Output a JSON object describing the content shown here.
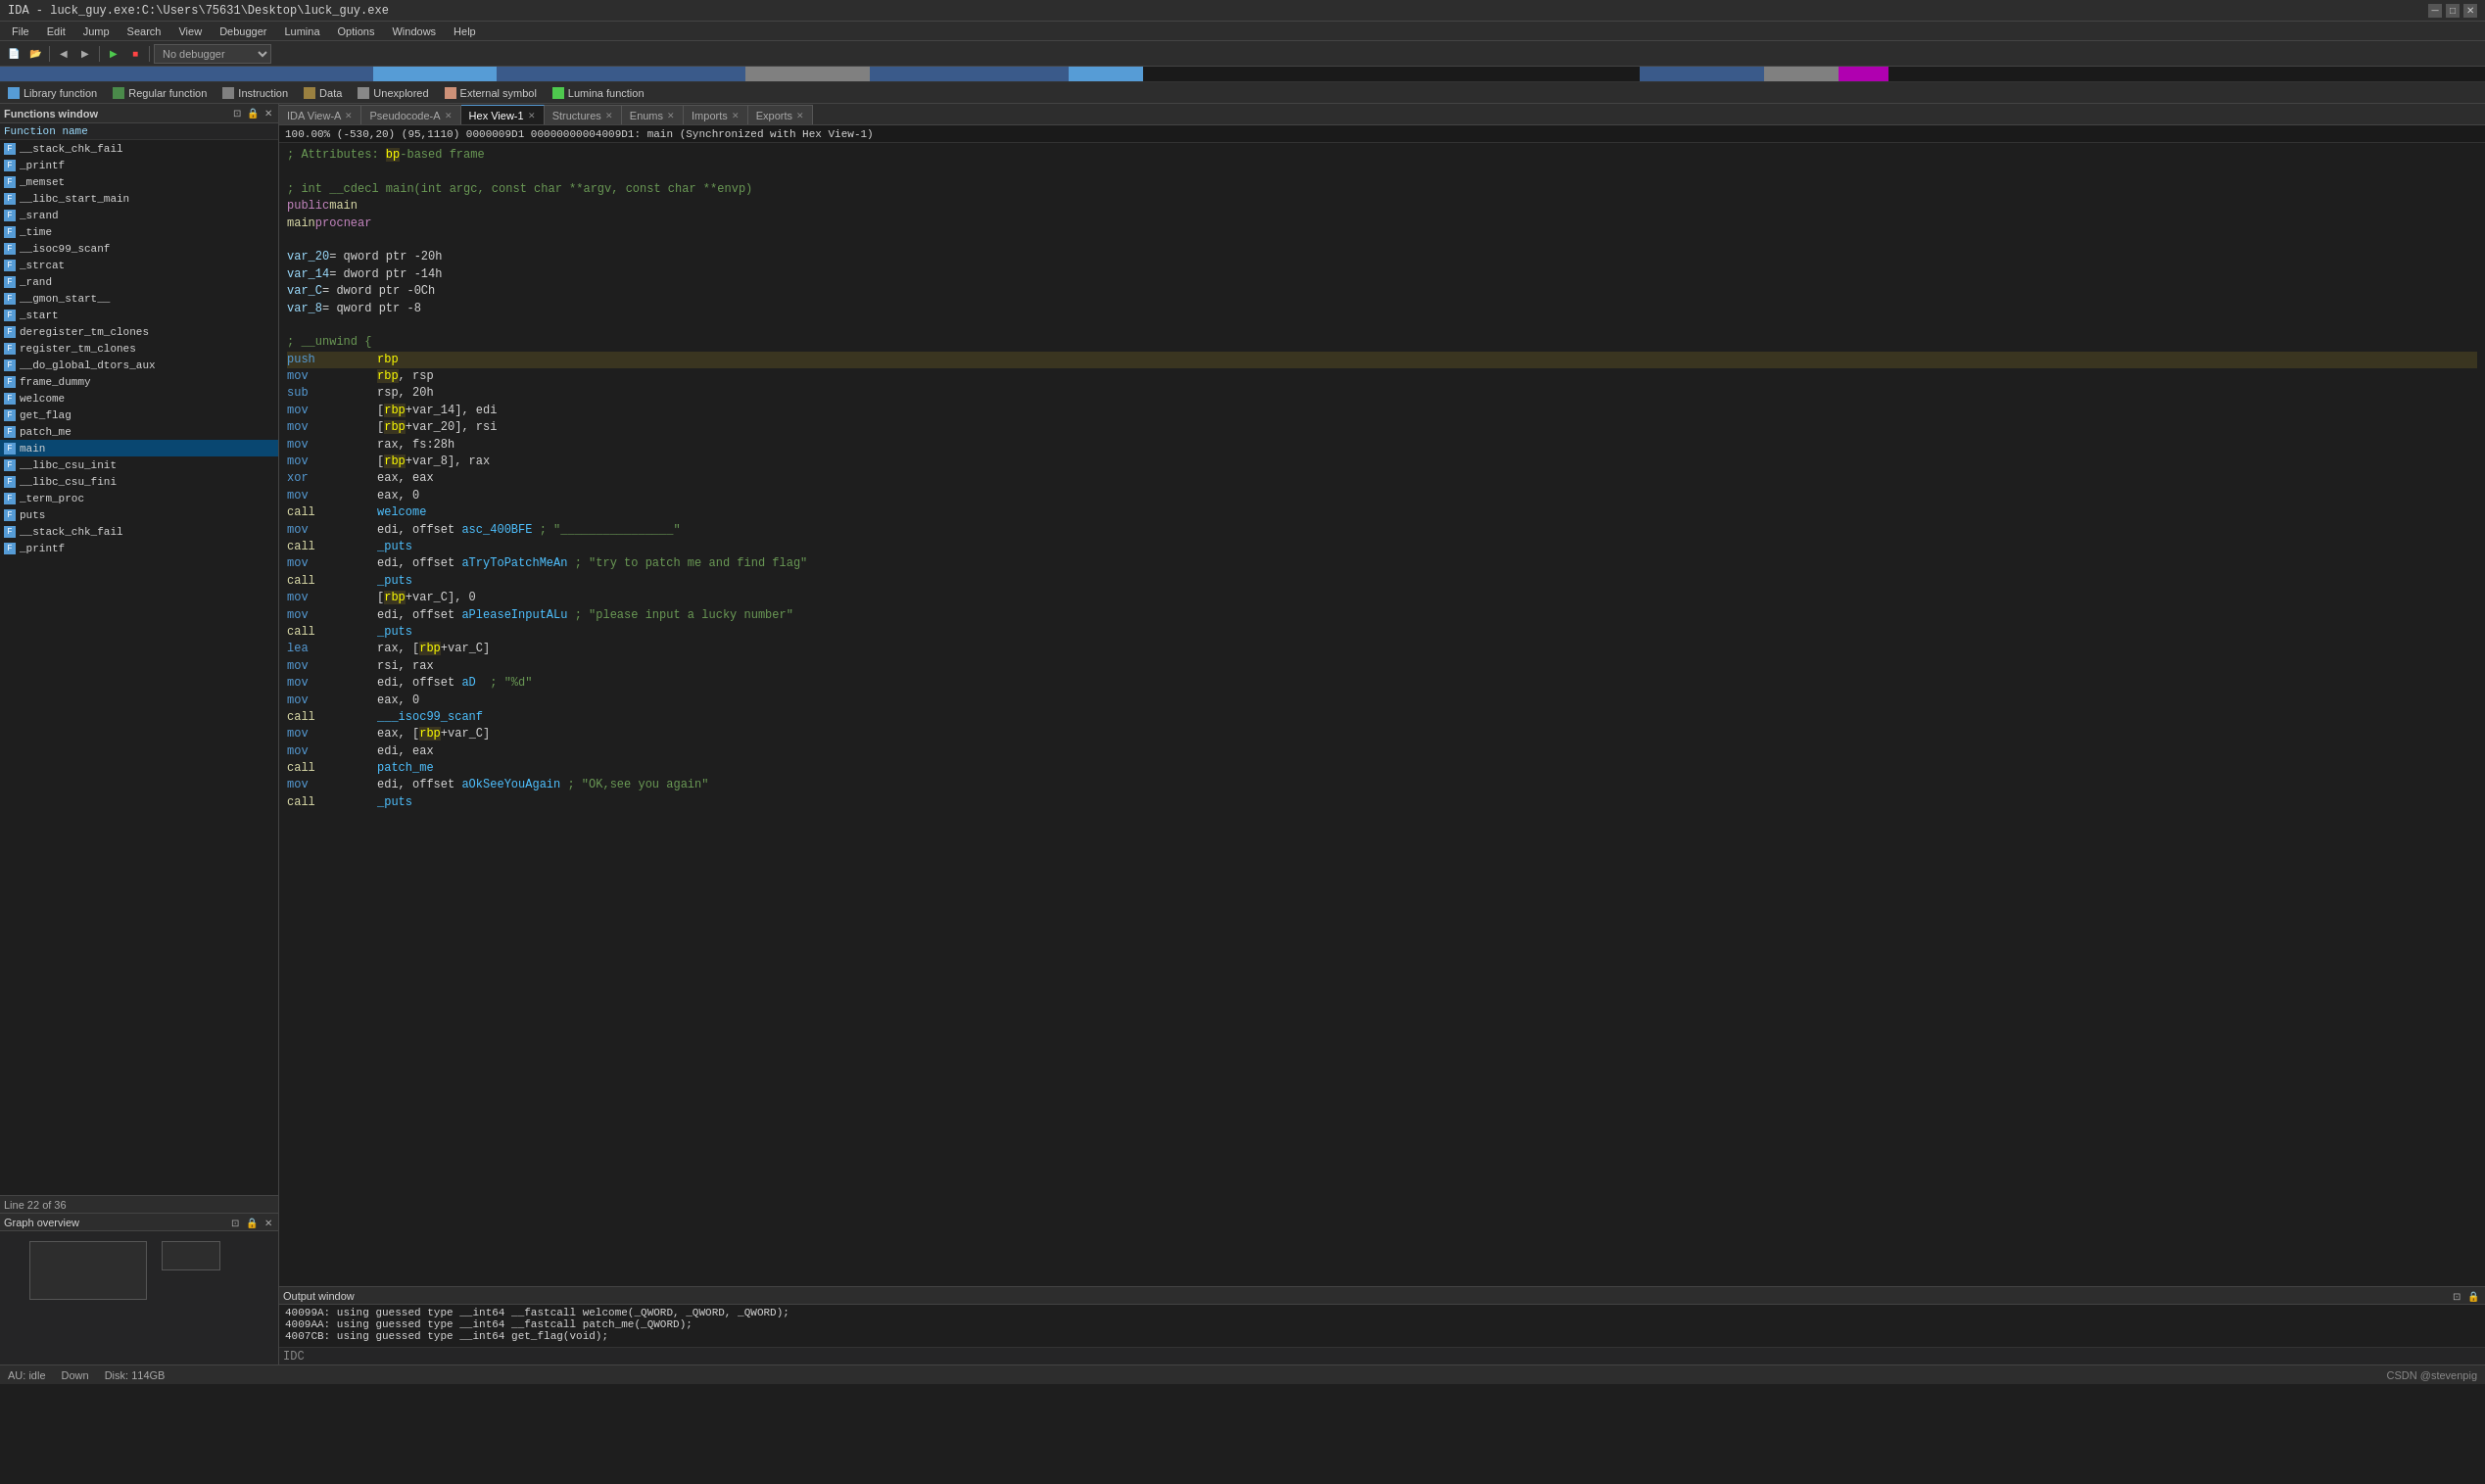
{
  "titlebar": {
    "title": "IDA - luck_guy.exe:C:\\Users\\75631\\Desktop\\luck_guy.exe"
  },
  "menubar": {
    "items": [
      "File",
      "Edit",
      "Jump",
      "Search",
      "View",
      "Debugger",
      "Lumina",
      "Options",
      "Windows",
      "Help"
    ]
  },
  "legend": {
    "items": [
      {
        "label": "Library function",
        "color": "#569cd6"
      },
      {
        "label": "Regular function",
        "color": "#569cd6"
      },
      {
        "label": "Instruction",
        "color": "#6a9955"
      },
      {
        "label": "Data",
        "color": "#808080"
      },
      {
        "label": "Unexplored",
        "color": "#888888"
      },
      {
        "label": "External symbol",
        "color": "#ce9178"
      },
      {
        "label": "Lumina function",
        "color": "#4ec94e"
      }
    ]
  },
  "tabs": [
    {
      "label": "IDA View-A",
      "active": false,
      "closeable": true
    },
    {
      "label": "Pseudocode-A",
      "active": false,
      "closeable": true
    },
    {
      "label": "Hex View-1",
      "active": true,
      "closeable": true
    },
    {
      "label": "Structures",
      "active": false,
      "closeable": true
    },
    {
      "label": "Enums",
      "active": false,
      "closeable": true
    },
    {
      "label": "Imports",
      "active": false,
      "closeable": true
    },
    {
      "label": "Exports",
      "active": false,
      "closeable": true
    }
  ],
  "functions_window": {
    "title": "Functions window",
    "column_header": "Function name",
    "functions": [
      {
        "name": "__stack_chk_fail",
        "icon": "F"
      },
      {
        "name": "_printf",
        "icon": "F"
      },
      {
        "name": "_memset",
        "icon": "F"
      },
      {
        "name": "__libc_start_main",
        "icon": "F"
      },
      {
        "name": "_srand",
        "icon": "F"
      },
      {
        "name": "_time",
        "icon": "F"
      },
      {
        "name": "__isoc99_scanf",
        "icon": "F"
      },
      {
        "name": "_strcat",
        "icon": "F"
      },
      {
        "name": "_rand",
        "icon": "F"
      },
      {
        "name": "__gmon_start__",
        "icon": "F"
      },
      {
        "name": "_start",
        "icon": "F"
      },
      {
        "name": "deregister_tm_clones",
        "icon": "F"
      },
      {
        "name": "register_tm_clones",
        "icon": "F"
      },
      {
        "name": "__do_global_dtors_aux",
        "icon": "F"
      },
      {
        "name": "frame_dummy",
        "icon": "F"
      },
      {
        "name": "welcome",
        "icon": "F"
      },
      {
        "name": "get_flag",
        "icon": "F"
      },
      {
        "name": "patch_me",
        "icon": "F"
      },
      {
        "name": "main",
        "icon": "F",
        "selected": true
      },
      {
        "name": "__libc_csu_init",
        "icon": "F"
      },
      {
        "name": "__libc_csu_fini",
        "icon": "F"
      },
      {
        "name": "_term_proc",
        "icon": "F"
      },
      {
        "name": "puts",
        "icon": "F"
      },
      {
        "name": "__stack_chk_fail",
        "icon": "F"
      },
      {
        "name": "_printf",
        "icon": "F"
      }
    ]
  },
  "line_count": "Line 22 of 36",
  "graph_overview": {
    "title": "Graph overview"
  },
  "code": {
    "header_comments": [
      "; Attributes: bp-based frame",
      "",
      "; int __cdecl main(int argc, const char **argv, const char **envp)",
      "public main",
      "main proc near",
      "",
      "var_20= qword ptr -20h",
      "var_14= dword ptr -14h",
      "var_C= dword ptr -0Ch",
      "var_8= qword ptr -8",
      "",
      "; __unwind {"
    ],
    "instructions": [
      {
        "label": "push",
        "operand": "rbp",
        "comment": ""
      },
      {
        "label": "mov",
        "operand": "rbp, rsp",
        "comment": ""
      },
      {
        "label": "sub",
        "operand": "rsp, 20h",
        "comment": ""
      },
      {
        "label": "mov",
        "operand": "[rbp+var_14], edi",
        "comment": ""
      },
      {
        "label": "mov",
        "operand": "[rbp+var_20], rsi",
        "comment": ""
      },
      {
        "label": "mov",
        "operand": "rax, fs:28h",
        "comment": ""
      },
      {
        "label": "mov",
        "operand": "[rbp+var_8], rax",
        "comment": ""
      },
      {
        "label": "xor",
        "operand": "eax, eax",
        "comment": ""
      },
      {
        "label": "mov",
        "operand": "eax, 0",
        "comment": ""
      },
      {
        "label": "call",
        "operand": "welcome",
        "comment": ""
      },
      {
        "label": "mov",
        "operand": "edi, offset asc_400BFE",
        "comment": "; \"________________\""
      },
      {
        "label": "call",
        "operand": "_puts",
        "comment": ""
      },
      {
        "label": "mov",
        "operand": "edi, offset aTryToPatchMeAn",
        "comment": "; \"try to patch me and find flag\""
      },
      {
        "label": "call",
        "operand": "_puts",
        "comment": ""
      },
      {
        "label": "mov",
        "operand": "[rbp+var_C], 0",
        "comment": ""
      },
      {
        "label": "mov",
        "operand": "edi, offset aPleaseInputALu",
        "comment": "; \"please input a lucky number\""
      },
      {
        "label": "call",
        "operand": "_puts",
        "comment": ""
      },
      {
        "label": "lea",
        "operand": "rax, [rbp+var_C]",
        "comment": ""
      },
      {
        "label": "mov",
        "operand": "rsi, rax",
        "comment": ""
      },
      {
        "label": "mov",
        "operand": "edi, offset aD",
        "comment": "; \"%d\""
      },
      {
        "label": "mov",
        "operand": "eax, 0",
        "comment": ""
      },
      {
        "label": "call",
        "operand": "___isoc99_scanf",
        "comment": ""
      },
      {
        "label": "mov",
        "operand": "eax, [rbp+var_C]",
        "comment": ""
      },
      {
        "label": "mov",
        "operand": "edi, eax",
        "comment": ""
      },
      {
        "label": "call",
        "operand": "patch_me",
        "comment": ""
      },
      {
        "label": "mov",
        "operand": "edi, offset aOkSeeYouAgain",
        "comment": "; \"OK,see you again\""
      },
      {
        "label": "call",
        "operand": "_puts",
        "comment": ""
      }
    ]
  },
  "address_bar": "100.00% (-530,20) (95,1110) 0000009D1 00000000004009D1: main (Synchronized with Hex View-1)",
  "output_window": {
    "title": "Output window",
    "lines": [
      "40099A: using guessed type __int64 __fastcall welcome(_QWORD, _QWORD, _QWORD);",
      "4009AA: using guessed type __int64 __fastcall patch_me(_QWORD);",
      "4007CB: using guessed type __int64 get_flag(void);"
    ],
    "input_prefix": "IDC"
  },
  "bottom_status": {
    "au_state": "AU: idle",
    "down": "Down",
    "disk": "Disk: 114GB",
    "right_text": "CSDN @stevenpig"
  }
}
